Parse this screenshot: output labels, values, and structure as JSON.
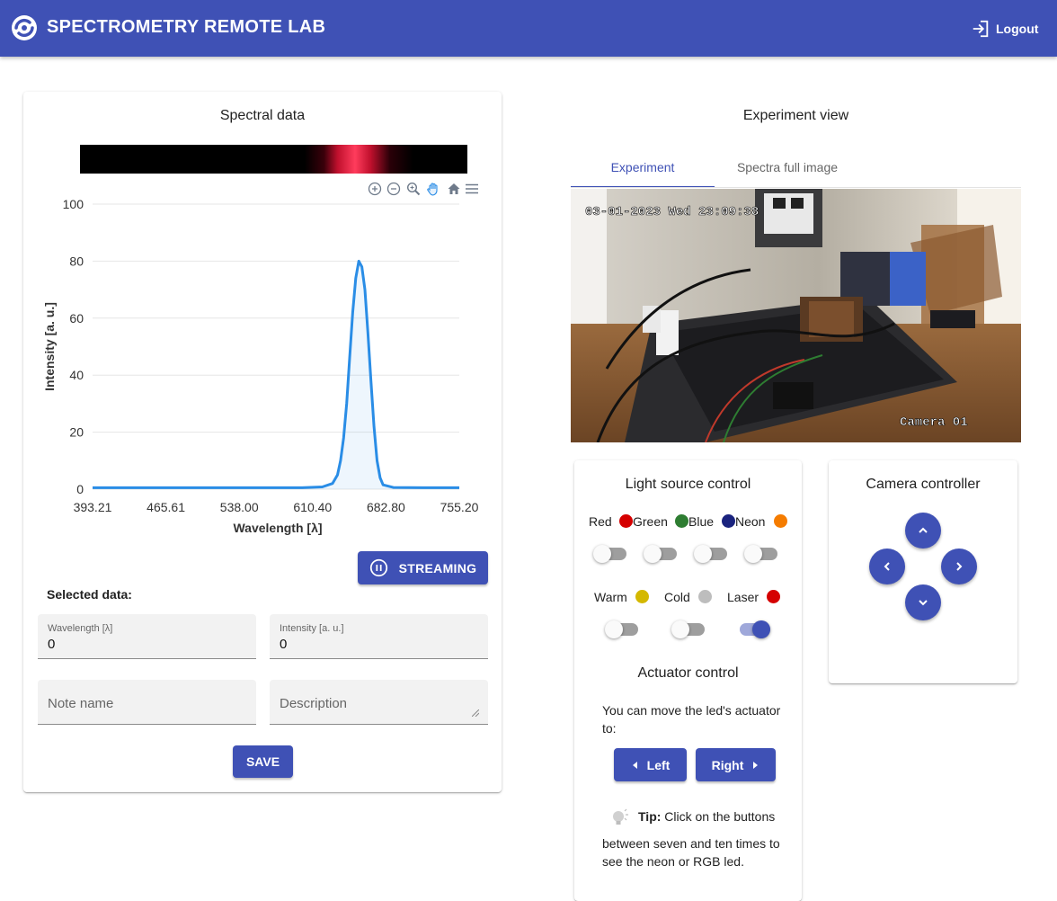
{
  "header": {
    "title": "SPECTROMETRY REMOTE LAB",
    "logout_label": "Logout",
    "bg_color": "#3f51b5"
  },
  "spectral": {
    "title": "Spectral data",
    "toolbar_icons": [
      "zoom-in-icon",
      "zoom-out-icon",
      "zoom-select-icon",
      "pan-icon",
      "home-icon",
      "menu-icon"
    ],
    "streaming_label": "STREAMING",
    "selected_label": "Selected data:",
    "wavelength_field": {
      "label": "Wavelength [λ]",
      "value": "0"
    },
    "intensity_field": {
      "label": "Intensity [a. u.]",
      "value": "0"
    },
    "note_placeholder": "Note name",
    "description_placeholder": "Description",
    "save_label": "SAVE"
  },
  "chart_data": {
    "type": "area",
    "title": "",
    "xlabel": "Wavelength [λ]",
    "ylabel": "Intensity [a. u.]",
    "x_ticks": [
      "393.21",
      "465.61",
      "538.00",
      "610.40",
      "682.80",
      "755.20"
    ],
    "y_ticks": [
      "0",
      "20",
      "40",
      "60",
      "80",
      "100"
    ],
    "xlim": [
      393.21,
      755.2
    ],
    "ylim": [
      0,
      100
    ],
    "grid": true,
    "series": [
      {
        "color": "#2a8de6",
        "points": [
          [
            393.21,
            0.5
          ],
          [
            450,
            0.5
          ],
          [
            500,
            0.5
          ],
          [
            560,
            0.5
          ],
          [
            600,
            0.5
          ],
          [
            620,
            0.8
          ],
          [
            630,
            2
          ],
          [
            635,
            5
          ],
          [
            638,
            10
          ],
          [
            641,
            18
          ],
          [
            644,
            30
          ],
          [
            647,
            46
          ],
          [
            650,
            62
          ],
          [
            653,
            74
          ],
          [
            656,
            80
          ],
          [
            659,
            78
          ],
          [
            662,
            70
          ],
          [
            665,
            55
          ],
          [
            668,
            38
          ],
          [
            671,
            22
          ],
          [
            674,
            10
          ],
          [
            677,
            4
          ],
          [
            680,
            1.5
          ],
          [
            690,
            0.6
          ],
          [
            720,
            0.5
          ],
          [
            755.2,
            0.5
          ]
        ]
      }
    ]
  },
  "experiment": {
    "title": "Experiment view",
    "tabs": [
      "Experiment",
      "Spectra full image"
    ],
    "timestamp": "03-01-2023 Wed 23:09:38",
    "camera_label": "Camera 01"
  },
  "light": {
    "title": "Light source control",
    "sources_row1": [
      {
        "name": "Red",
        "color": "#d50000",
        "on": false
      },
      {
        "name": "Green",
        "color": "#2e7d32",
        "on": false
      },
      {
        "name": "Blue",
        "color": "#1a237e",
        "on": false
      },
      {
        "name": "Neon",
        "color": "#f57c00",
        "on": false
      }
    ],
    "sources_row2": [
      {
        "name": "Warm",
        "color": "#d4b800",
        "on": false
      },
      {
        "name": "Cold",
        "color": "#bdbdbd",
        "on": false
      },
      {
        "name": "Laser",
        "color": "#d50000",
        "on": true
      }
    ],
    "actuator_title": "Actuator control",
    "actuator_desc": "You can move the led's actuator to:",
    "left_label": "Left",
    "right_label": "Right",
    "tip_bold": "Tip:",
    "tip_text_first": " Click on the buttons",
    "tip_text_rest": "between seven and ten times to see the neon or RGB led."
  },
  "camera_controller": {
    "title": "Camera controller",
    "buttons": [
      "up-icon",
      "left-icon",
      "right-icon",
      "down-icon"
    ]
  }
}
